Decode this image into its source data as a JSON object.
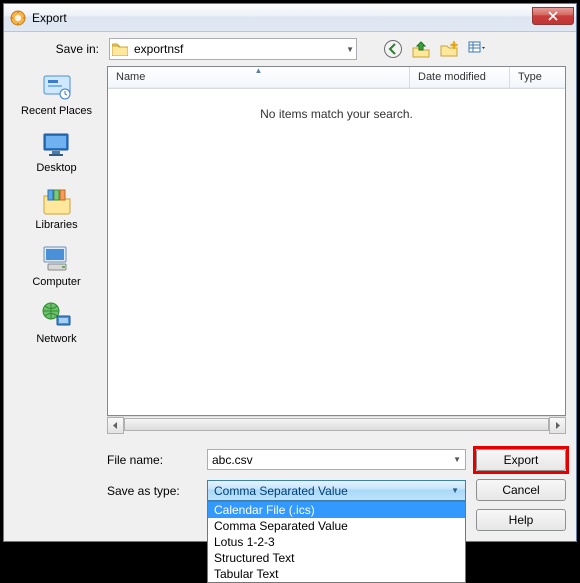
{
  "window": {
    "title": "Export"
  },
  "savein": {
    "label": "Save in:",
    "value": "exportnsf"
  },
  "columns": {
    "name": "Name",
    "date": "Date modified",
    "type": "Type"
  },
  "list": {
    "empty_msg": "No items match your search."
  },
  "places": {
    "recent": "Recent Places",
    "desktop": "Desktop",
    "libraries": "Libraries",
    "computer": "Computer",
    "network": "Network"
  },
  "form": {
    "filename_label": "File name:",
    "filename_value": "abc.csv",
    "type_label": "Save as type:",
    "type_value": "Comma Separated Value",
    "type_options": [
      "Calendar File (.ics)",
      "Comma Separated Value",
      "Lotus 1-2-3",
      "Structured Text",
      "Tabular Text"
    ],
    "selected_index": 0
  },
  "buttons": {
    "export": "Export",
    "cancel": "Cancel",
    "help": "Help"
  }
}
